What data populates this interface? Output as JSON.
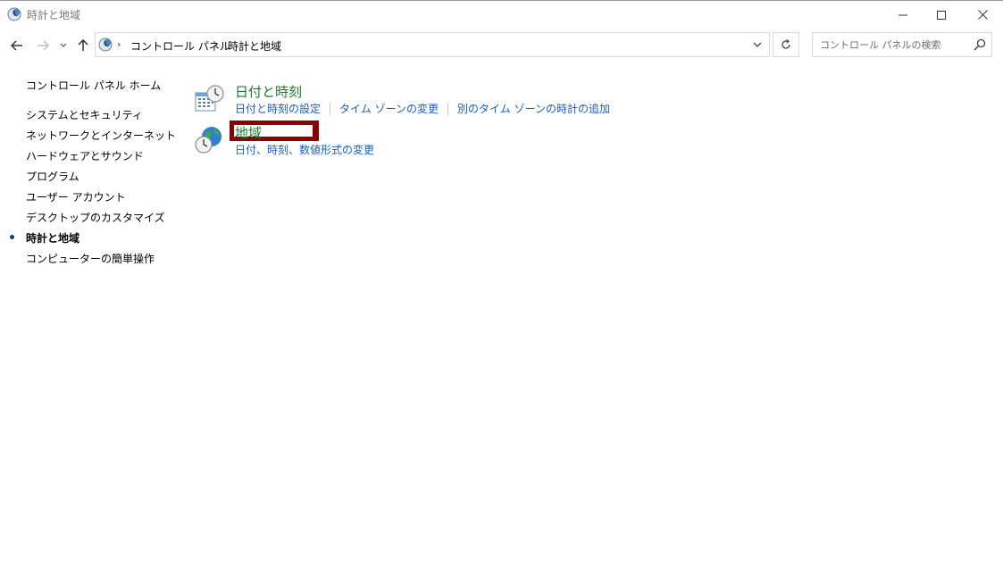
{
  "window": {
    "title": "時計と地域"
  },
  "address": {
    "crumbs": [
      "コントロール パネル",
      "時計と地域"
    ]
  },
  "search": {
    "placeholder": "コントロール パネルの検索"
  },
  "sidebar": {
    "home": "コントロール パネル ホーム",
    "items": [
      "システムとセキュリティ",
      "ネットワークとインターネット",
      "ハードウェアとサウンド",
      "プログラム",
      "ユーザー アカウント",
      "デスクトップのカスタマイズ",
      "時計と地域",
      "コンピューターの簡単操作"
    ],
    "current_index": 6
  },
  "categories": [
    {
      "title": "日付と時刻",
      "links": [
        "日付と時刻の設定",
        "タイム ゾーンの変更",
        "別のタイム ゾーンの時計の追加"
      ]
    },
    {
      "title": "地域",
      "links": [
        "日付、時刻、数値形式の変更"
      ]
    }
  ],
  "colors": {
    "category_title": "#1e7a2e",
    "link": "#1a5fb4",
    "highlight": "#8b0000"
  },
  "icons": {
    "app": "clock-globe-icon",
    "date_time": "calendar-clock-icon",
    "region": "globe-clock-icon"
  }
}
